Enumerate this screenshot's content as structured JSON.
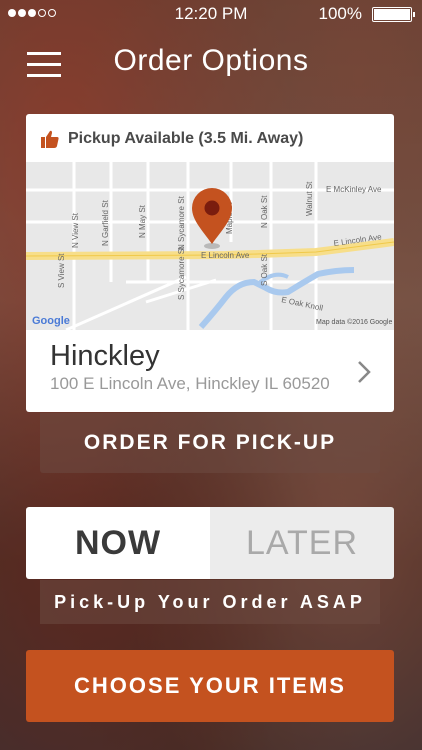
{
  "status_bar": {
    "time": "12:20 PM",
    "battery": "100%",
    "signal_dots_filled": 3,
    "signal_dots_total": 5
  },
  "header": {
    "title": "Order Options"
  },
  "location_card": {
    "pickup_status": "Pickup Available (3.5 Mi. Away)",
    "name": "Hinckley",
    "address": "100 E Lincoln Ave, Hinckley IL 60520",
    "map": {
      "streets": {
        "main": "E Lincoln Ave",
        "main_right": "E Lincoln Ave",
        "mckinley": "E McKinley Ave",
        "n_view": "N View St",
        "n_garfield": "N Garfield St",
        "n_may": "N May St",
        "n_sycamore": "N Sycamore St",
        "s_sycamore": "S Sycamore St",
        "s_view": "S View St",
        "maple": "Maple St",
        "n_oak": "N Oak St",
        "s_oak": "S Oak St",
        "walnut": "Walnut St",
        "oak_knoll": "E Oak Knoll"
      },
      "google_logo": "Google",
      "attribution": "Map data ©2016 Google"
    }
  },
  "buttons": {
    "order_pickup": "ORDER FOR PICK-UP",
    "choose_items": "CHOOSE YOUR ITEMS"
  },
  "timing": {
    "now": "NOW",
    "later": "LATER",
    "selected": "now",
    "subtitle": "Pick-Up Your Order ASAP"
  },
  "colors": {
    "accent": "#c4521f",
    "pin": "#c4521f"
  }
}
